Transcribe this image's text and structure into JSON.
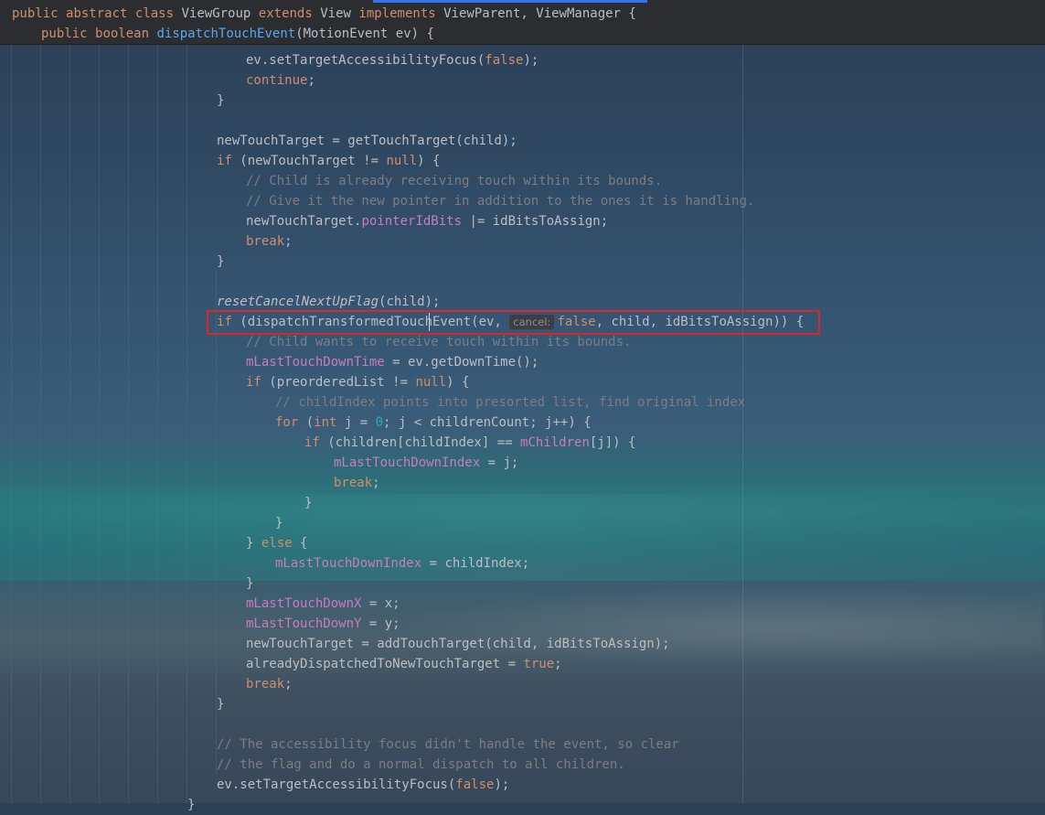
{
  "header": {
    "line1": {
      "kw_public": "public",
      "kw_abstract": "abstract",
      "kw_class": "class",
      "class_name": "ViewGroup",
      "kw_extends": "extends",
      "parent": "View",
      "kw_implements": "implements",
      "interfaces": "ViewParent, ViewManager {"
    },
    "line2": {
      "kw_public": "public",
      "kw_boolean": "boolean",
      "method": "dispatchTouchEvent",
      "params": "(MotionEvent ev) {"
    }
  },
  "code": {
    "l1a": "ev.setTargetAccessibilityFocus(",
    "false": "false",
    "semi_close": ");",
    "continue": "continue",
    "semi": ";",
    "brace_close": "}",
    "l_newTouchTarget": "newTouchTarget = getTouchTarget(child);",
    "if": "if",
    "l_if_newtt_a": " (newTouchTarget != ",
    "null": "null",
    "l_if_newtt_b": ") {",
    "c_child_receiving": "// Child is already receiving touch within its bounds.",
    "c_give_pointer": "// Give it the new pointer in addition to the ones it is handling.",
    "l_pointer_a": "newTouchTarget.",
    "pointerIdBits": "pointerIdBits",
    "l_pointer_b": " |= idBitsToAssign;",
    "break": "break",
    "reset_fn": "resetCancelNextUpFlag",
    "reset_args": "(child);",
    "l_dispatch_a": " (dispatchTransformedTouchEvent(ev, ",
    "hint_cancel": "cancel:",
    "l_dispatch_b": ", child, idBitsToAssign)) {",
    "c_child_wants": "// Child wants to receive touch within its bounds.",
    "mLastTouchDownTime": "mLastTouchDownTime",
    "l_downtime_b": " = ev.getDownTime();",
    "l_preordered_a": " (preorderedList != ",
    "l_preordered_b": ") {",
    "c_childindex": "// childIndex points into presorted list, find original index",
    "for": "for",
    "l_for_a": " (",
    "int": "int",
    "l_for_b": " j = ",
    "zero": "0",
    "l_for_c": "; j < childrenCount; j++) {",
    "l_children_a": " (children[childIndex] == ",
    "mChildren": "mChildren",
    "l_children_b": "[j]) {",
    "mLastTouchDownIndex": "mLastTouchDownIndex",
    "l_eq_j": " = j;",
    "else_a": "} ",
    "else": "else",
    "else_b": " {",
    "l_eq_childindex": " = childIndex;",
    "mLastTouchDownX": "mLastTouchDownX",
    "l_eq_x": " = x;",
    "mLastTouchDownY": "mLastTouchDownY",
    "l_eq_y": " = y;",
    "l_addtouch": "newTouchTarget = addTouchTarget(child, idBitsToAssign);",
    "l_already_a": "alreadyDispatchedToNewTouchTarget = ",
    "true": "true",
    "c_focus_clear": "// The accessibility focus didn't handle the event, so clear",
    "c_flag_normal": "// the flag and do a normal dispatch to all children."
  }
}
